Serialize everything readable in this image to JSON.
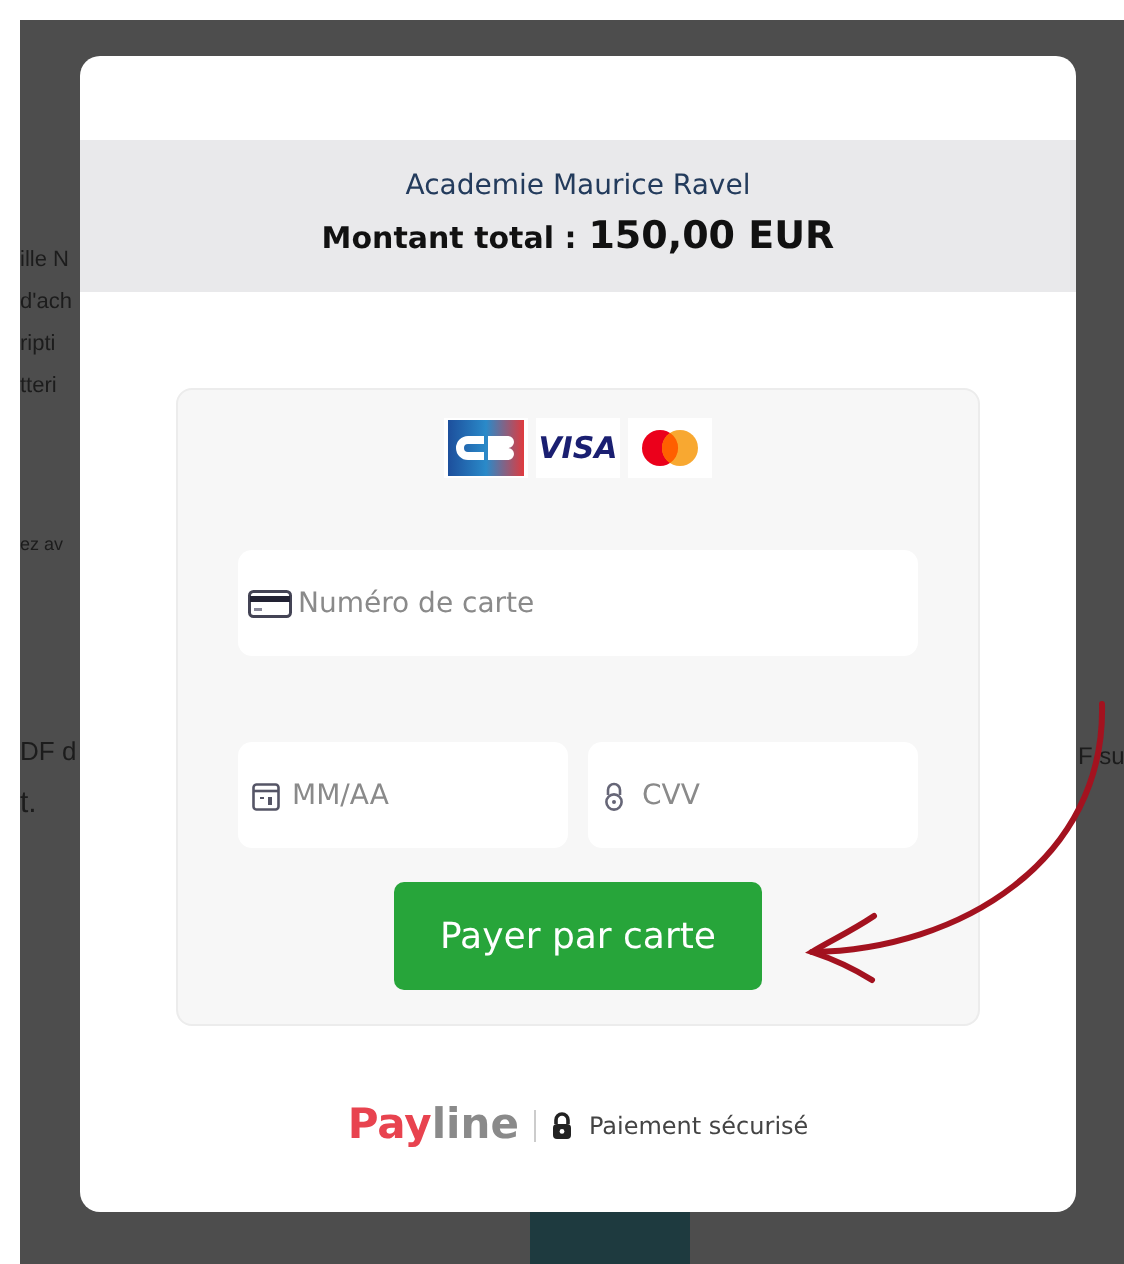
{
  "background_page": {
    "left_fragments": [
      "ille N",
      "d'ach",
      "ripti",
      "tteri",
      "ez av",
      "DF d",
      "t."
    ],
    "right_fragments": [
      "F su"
    ]
  },
  "modal": {
    "merchant": "Academie Maurice Ravel",
    "total_label": "Montant total :",
    "total_amount": "150,00 EUR",
    "card_brands": [
      {
        "kind": "cb"
      },
      {
        "kind": "visa",
        "label": "VISA"
      },
      {
        "kind": "mastercard"
      }
    ],
    "fields": [
      {
        "kind": "card",
        "placeholder": "Numéro de carte"
      },
      {
        "kind": "expiry",
        "placeholder": "MM/AA"
      },
      {
        "kind": "cvv",
        "placeholder": "CVV"
      }
    ],
    "pay_button": "Payer par carte",
    "footer": {
      "brand_parts": [
        "Pay",
        "line"
      ],
      "secure_label": "Paiement sécurisé"
    }
  }
}
